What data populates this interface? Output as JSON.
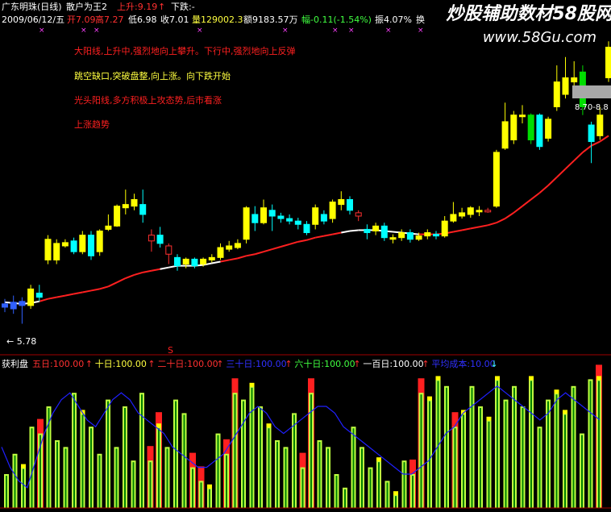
{
  "header": {
    "stock": "广东明珠(日线)",
    "indicator": "散户为王2",
    "up_label": "上升:9.19",
    "up_arrow": "↑",
    "down_label": "下跌:-",
    "date": "2009/06/12/五",
    "open": "开7.09",
    "high": "高7.27",
    "low": "低6.98",
    "close": "收7.01",
    "volume": "量129002.3",
    "amount": "额9183.57万",
    "change": "幅-0.11(-1.54%)",
    "amplitude": "振4.07%",
    "turnover": "换"
  },
  "watermark": {
    "line1": "炒股辅助数材58股网",
    "line2": "www.58Gu.com"
  },
  "annotations": [
    {
      "text": "大阳线,上升中,强烈地向上攀升。下行中,强烈地向上反弹",
      "color": "#ff2020"
    },
    {
      "text": "跳空缺口,突破盘整,向上涨。向下跌开始",
      "color": "#ffff40"
    },
    {
      "text": "光头阳线,多方积极上攻态势,后市看涨",
      "color": "#ff2020"
    },
    {
      "text": "上涨趋势",
      "color": "#ff2020"
    }
  ],
  "price_labels": {
    "low_marker": "← 5.78",
    "right_value": "8.70-8.8"
  },
  "lower_panel": {
    "name": "获利盘",
    "items": [
      {
        "text": "五日:100.00",
        "color": "#ff3030",
        "arrow": "↑",
        "arrow_color": "#ff3030"
      },
      {
        "text": "十日:100.00",
        "color": "#ffff40",
        "arrow": "↑",
        "arrow_color": "#ff3030"
      },
      {
        "text": "二十日:100.00",
        "color": "#ff3030",
        "arrow": "↑",
        "arrow_color": "#ff3030"
      },
      {
        "text": "三十日:100.00",
        "color": "#3030ff",
        "arrow": "↑",
        "arrow_color": "#ff3030"
      },
      {
        "text": "六十日:100.00",
        "color": "#40ff40",
        "arrow": "↑",
        "arrow_color": "#ff3030"
      },
      {
        "text": "一百日:100.00",
        "color": "#ffffff",
        "arrow": "↑",
        "arrow_color": "#ff3030"
      },
      {
        "text": "平均成本:10.00",
        "color": "#3030ff",
        "arrow": "↓",
        "arrow_color": "#40ffff"
      }
    ],
    "s_marker": "S"
  },
  "colors": {
    "up": "#ffff00",
    "down": "#00ffff",
    "green_candle": "#00dd00",
    "ma_red": "#ff2020",
    "ma_white": "#ffffff",
    "blue_line": "#2020ff",
    "axis": "#a00000"
  },
  "chart_data": {
    "type": "candlestick",
    "title": "",
    "candles": [
      {
        "o": 5.98,
        "c": 6.02,
        "h": 6.08,
        "l": 5.92
      },
      {
        "o": 5.96,
        "c": 6.04,
        "h": 6.12,
        "l": 5.9
      },
      {
        "o": 6.0,
        "c": 6.05,
        "h": 6.1,
        "l": 5.78
      },
      {
        "o": 6.0,
        "c": 6.2,
        "h": 6.25,
        "l": 5.96
      },
      {
        "o": 6.15,
        "c": 6.1,
        "h": 6.25,
        "l": 6.05
      },
      {
        "o": 6.55,
        "c": 6.8,
        "h": 6.85,
        "l": 6.5
      },
      {
        "o": 6.55,
        "c": 6.75,
        "h": 6.8,
        "l": 6.5
      },
      {
        "o": 6.72,
        "c": 6.76,
        "h": 6.8,
        "l": 6.7
      },
      {
        "o": 6.78,
        "c": 6.65,
        "h": 6.82,
        "l": 6.62
      },
      {
        "o": 6.65,
        "c": 6.85,
        "h": 6.9,
        "l": 6.62
      },
      {
        "o": 6.85,
        "c": 6.6,
        "h": 6.9,
        "l": 6.55
      },
      {
        "o": 6.65,
        "c": 6.9,
        "h": 6.92,
        "l": 6.6
      },
      {
        "o": 6.92,
        "c": 6.96,
        "h": 7.1,
        "l": 6.9
      },
      {
        "o": 6.96,
        "c": 7.2,
        "h": 7.22,
        "l": 6.95
      },
      {
        "o": 7.18,
        "c": 7.22,
        "h": 7.4,
        "l": 7.1
      },
      {
        "o": 7.2,
        "c": 7.28,
        "h": 7.35,
        "l": 7.15
      },
      {
        "o": 7.22,
        "c": 7.1,
        "h": 7.4,
        "l": 7.0
      },
      {
        "o": 6.85,
        "c": 6.78,
        "h": 6.92,
        "l": 6.65
      },
      {
        "o": 6.85,
        "c": 6.75,
        "h": 6.95,
        "l": 6.7
      },
      {
        "o": 6.72,
        "c": 6.62,
        "h": 6.75,
        "l": 6.5
      },
      {
        "o": 6.58,
        "c": 6.48,
        "h": 6.62,
        "l": 6.42
      },
      {
        "o": 6.5,
        "c": 6.56,
        "h": 6.58,
        "l": 6.45
      },
      {
        "o": 6.56,
        "c": 6.48,
        "h": 6.58,
        "l": 6.45
      },
      {
        "o": 6.5,
        "c": 6.56,
        "h": 6.58,
        "l": 6.47
      },
      {
        "o": 6.55,
        "c": 6.58,
        "h": 6.62,
        "l": 6.52
      },
      {
        "o": 6.58,
        "c": 6.7,
        "h": 6.75,
        "l": 6.55
      },
      {
        "o": 6.68,
        "c": 6.72,
        "h": 6.78,
        "l": 6.65
      },
      {
        "o": 6.7,
        "c": 6.75,
        "h": 6.8,
        "l": 6.68
      },
      {
        "o": 6.8,
        "c": 7.18,
        "h": 7.2,
        "l": 6.75
      },
      {
        "o": 7.1,
        "c": 7.0,
        "h": 7.2,
        "l": 6.9
      },
      {
        "o": 7.0,
        "c": 7.18,
        "h": 7.28,
        "l": 6.98
      },
      {
        "o": 7.15,
        "c": 7.08,
        "h": 7.22,
        "l": 6.9
      },
      {
        "o": 7.08,
        "c": 7.05,
        "h": 7.12,
        "l": 7.0
      },
      {
        "o": 7.05,
        "c": 7.02,
        "h": 7.1,
        "l": 6.98
      },
      {
        "o": 7.02,
        "c": 6.98,
        "h": 7.06,
        "l": 6.92
      },
      {
        "o": 6.98,
        "c": 6.88,
        "h": 7.02,
        "l": 6.85
      },
      {
        "o": 6.98,
        "c": 7.18,
        "h": 7.22,
        "l": 6.92
      },
      {
        "o": 7.1,
        "c": 7.02,
        "h": 7.15,
        "l": 6.98
      },
      {
        "o": 7.05,
        "c": 7.25,
        "h": 7.28,
        "l": 7.0
      },
      {
        "o": 7.22,
        "c": 7.28,
        "h": 7.38,
        "l": 7.15
      },
      {
        "o": 7.28,
        "c": 7.15,
        "h": 7.32,
        "l": 7.1
      },
      {
        "o": 7.12,
        "c": 7.08,
        "h": 7.15,
        "l": 7.02
      },
      {
        "o": 6.92,
        "c": 6.88,
        "h": 6.98,
        "l": 6.8
      },
      {
        "o": 6.9,
        "c": 6.96,
        "h": 7.0,
        "l": 6.85
      },
      {
        "o": 6.96,
        "c": 6.82,
        "h": 7.0,
        "l": 6.78
      },
      {
        "o": 6.8,
        "c": 6.82,
        "h": 6.86,
        "l": 6.75
      },
      {
        "o": 6.82,
        "c": 6.88,
        "h": 6.92,
        "l": 6.78
      },
      {
        "o": 6.88,
        "c": 6.8,
        "h": 6.92,
        "l": 6.76
      },
      {
        "o": 6.8,
        "c": 6.84,
        "h": 6.88,
        "l": 6.78
      },
      {
        "o": 6.84,
        "c": 6.88,
        "h": 6.92,
        "l": 6.8
      },
      {
        "o": 6.86,
        "c": 6.84,
        "h": 6.9,
        "l": 6.8
      },
      {
        "o": 6.84,
        "c": 7.02,
        "h": 7.08,
        "l": 6.82
      },
      {
        "o": 7.02,
        "c": 7.1,
        "h": 7.25,
        "l": 7.0
      },
      {
        "o": 7.08,
        "c": 7.12,
        "h": 7.18,
        "l": 7.05
      },
      {
        "o": 7.1,
        "c": 7.18,
        "h": 7.2,
        "l": 7.06
      },
      {
        "o": 7.15,
        "c": 7.15,
        "h": 7.2,
        "l": 7.08
      },
      {
        "o": 7.14,
        "c": 7.15,
        "h": 7.18,
        "l": 7.12
      },
      {
        "o": 7.2,
        "c": 7.85,
        "h": 7.88,
        "l": 7.18
      },
      {
        "o": 7.9,
        "c": 8.22,
        "h": 8.45,
        "l": 7.88
      },
      {
        "o": 8.0,
        "c": 8.3,
        "h": 8.35,
        "l": 7.95
      },
      {
        "o": 8.28,
        "c": 8.3,
        "h": 8.42,
        "l": 8.2
      },
      {
        "o": 8.3,
        "c": 8.0,
        "h": 8.32,
        "l": 7.95
      },
      {
        "o": 8.3,
        "c": 7.92,
        "h": 8.32,
        "l": 7.88
      },
      {
        "o": 8.02,
        "c": 8.25,
        "h": 8.28,
        "l": 7.98
      },
      {
        "o": 8.4,
        "c": 8.7,
        "h": 8.9,
        "l": 8.35
      },
      {
        "o": 8.55,
        "c": 8.75,
        "h": 9.0,
        "l": 8.5
      },
      {
        "o": 8.7,
        "c": 8.75,
        "h": 8.95,
        "l": 8.6
      },
      {
        "o": 8.82,
        "c": 8.4,
        "h": 8.9,
        "l": 8.3
      },
      {
        "o": 8.18,
        "c": 7.98,
        "h": 8.22,
        "l": 7.72
      },
      {
        "o": 8.05,
        "c": 8.3,
        "h": 8.4,
        "l": 8.0
      },
      {
        "o": 8.75,
        "c": 9.12,
        "h": 9.19,
        "l": 8.7
      }
    ],
    "ma": [
      6.04,
      6.03,
      6.02,
      6.03,
      6.05,
      6.08,
      6.1,
      6.12,
      6.14,
      6.16,
      6.18,
      6.2,
      6.23,
      6.28,
      6.33,
      6.37,
      6.4,
      6.42,
      6.44,
      6.46,
      6.48,
      6.48,
      6.48,
      6.49,
      6.51,
      6.53,
      6.55,
      6.57,
      6.6,
      6.62,
      6.65,
      6.68,
      6.71,
      6.74,
      6.77,
      6.79,
      6.82,
      6.84,
      6.86,
      6.88,
      6.9,
      6.91,
      6.91,
      6.91,
      6.9,
      6.89,
      6.88,
      6.87,
      6.86,
      6.86,
      6.86,
      6.87,
      6.89,
      6.91,
      6.93,
      6.95,
      6.97,
      7.0,
      7.05,
      7.12,
      7.2,
      7.28,
      7.36,
      7.45,
      7.55,
      7.65,
      7.75,
      7.85,
      7.93,
      7.98,
      8.05
    ],
    "ma_white_until": 5,
    "ma_white_range": [
      19,
      25
    ],
    "ma_white_range2": [
      40,
      48
    ],
    "ylim": [
      5.6,
      9.3
    ],
    "profit_bars": {
      "values": [
        25,
        40,
        30,
        60,
        55,
        75,
        50,
        45,
        85,
        70,
        60,
        40,
        80,
        45,
        75,
        35,
        85,
        35,
        60,
        45,
        80,
        70,
        30,
        20,
        15,
        55,
        40,
        85,
        80,
        90,
        75,
        60,
        50,
        45,
        70,
        30,
        85,
        50,
        45,
        25,
        15,
        60,
        45,
        30,
        35,
        20,
        10,
        35,
        25,
        85,
        80,
        95,
        90,
        60,
        70,
        90,
        75,
        65,
        95,
        80,
        90,
        75,
        95,
        60,
        80,
        85,
        70,
        90,
        55,
        95,
        95
      ],
      "red": [
        4,
        17,
        18,
        22,
        23,
        26,
        27,
        35,
        36,
        48,
        49,
        53,
        70
      ],
      "yellow_tip": [
        2,
        9,
        18,
        24,
        29,
        31,
        44,
        46,
        50,
        51,
        54,
        57,
        58,
        62,
        65,
        66,
        70
      ],
      "ylim": [
        0,
        100
      ]
    },
    "cost_line": [
      45,
      30,
      20,
      15,
      35,
      55,
      70,
      80,
      85,
      75,
      65,
      60,
      70,
      80,
      85,
      80,
      70,
      65,
      60,
      55,
      45,
      40,
      35,
      30,
      30,
      35,
      40,
      50,
      60,
      70,
      75,
      70,
      60,
      55,
      60,
      65,
      70,
      75,
      75,
      70,
      60,
      55,
      50,
      45,
      40,
      35,
      30,
      25,
      25,
      30,
      35,
      45,
      55,
      60,
      70,
      75,
      80,
      85,
      90,
      85,
      80,
      75,
      70,
      65,
      70,
      80,
      85,
      80,
      75,
      70,
      65
    ]
  }
}
